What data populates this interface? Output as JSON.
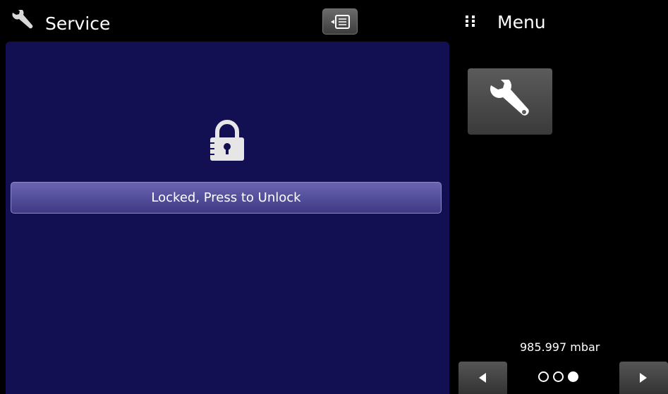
{
  "header": {
    "title": "Service",
    "icon": "wrench-icon",
    "center_button_icon": "display-list-icon"
  },
  "main": {
    "lock_icon": "padlock-icon",
    "unlock_button_label": "Locked, Press to Unlock",
    "panel_color": "#121052",
    "button_color": "#4f4a99"
  },
  "menu": {
    "title": "Menu",
    "icon": "grid-dots-icon",
    "tiles": [
      {
        "icon": "wrench-icon"
      }
    ]
  },
  "footer": {
    "pressure_readout": "985.997 mbar",
    "prev_icon": "triangle-left-icon",
    "next_icon": "triangle-right-icon",
    "page_count": 3,
    "active_page": 3
  }
}
